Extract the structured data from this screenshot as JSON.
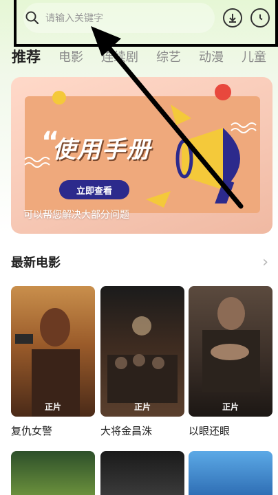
{
  "search": {
    "placeholder": "请输入关键字",
    "download_icon": "download-icon",
    "history_icon": "clock-icon"
  },
  "tabs": [
    {
      "label": "推荐",
      "active": true
    },
    {
      "label": "电影",
      "active": false
    },
    {
      "label": "连续剧",
      "active": false
    },
    {
      "label": "综艺",
      "active": false
    },
    {
      "label": "动漫",
      "active": false
    },
    {
      "label": "儿童",
      "active": false
    }
  ],
  "banner": {
    "title": "使用手册",
    "button_label": "立即查看",
    "caption": "可以帮您解决大部分问题"
  },
  "latest": {
    "title": "最新电影",
    "movies": [
      {
        "name": "复仇女警",
        "badge": "正片"
      },
      {
        "name": "大将金昌洙",
        "badge": "正片"
      },
      {
        "name": "以眼还眼",
        "badge": "正片"
      }
    ]
  },
  "colors": {
    "accent_green": "#e6f7d5",
    "banner_button": "#2c2a8c",
    "banner_card": "#efa97c"
  }
}
